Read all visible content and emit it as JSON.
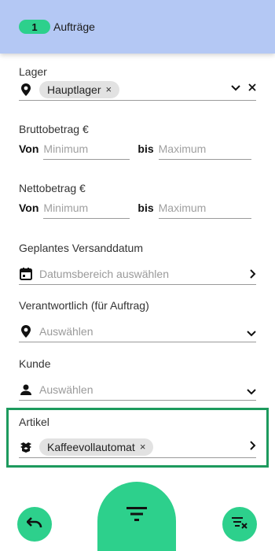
{
  "header": {
    "count": "1",
    "title": "Aufträge"
  },
  "lager": {
    "label": "Lager",
    "chip": "Hauptlager",
    "chip_remove": "×",
    "expand_icon": "chevron-down-icon",
    "clear_icon": "close-icon"
  },
  "brutto": {
    "label": "Bruttobetrag €",
    "from_label": "Von",
    "from_placeholder": "Minimum",
    "to_label": "bis",
    "to_placeholder": "Maximum"
  },
  "netto": {
    "label": "Nettobetrag €",
    "from_label": "Von",
    "from_placeholder": "Minimum",
    "to_label": "bis",
    "to_placeholder": "Maximum"
  },
  "versand": {
    "label": "Geplantes Versanddatum",
    "placeholder": "Datumsbereich auswählen",
    "icon": "calendar-icon"
  },
  "verantwortlich": {
    "label": "Verantwortlich (für Auftrag)",
    "placeholder": "Auswählen",
    "icon": "location-pin-icon"
  },
  "kunde": {
    "label": "Kunde",
    "placeholder": "Auswählen",
    "icon": "person-icon"
  },
  "artikel": {
    "label": "Artikel",
    "chip": "Kaffeevollautomat",
    "chip_remove": "×",
    "icon": "box-icon"
  },
  "actions": {
    "undo_icon": "undo-icon",
    "filter_icon": "filter-icon",
    "clear_filter_icon": "filter-clear-icon"
  },
  "colors": {
    "accent": "#2dd08c",
    "header": "#b4c8f4",
    "highlight": "#1d9a5d"
  }
}
